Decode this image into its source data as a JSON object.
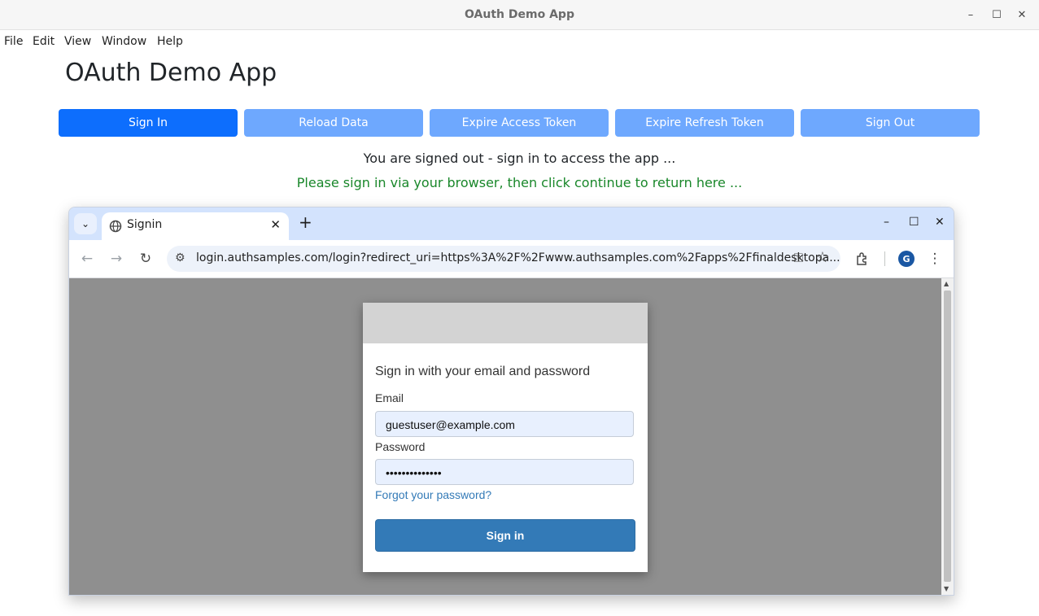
{
  "window": {
    "title": "OAuth Demo App",
    "controls": {
      "minimize": "–",
      "maximize": "☐",
      "close": "✕"
    }
  },
  "menubar": {
    "items": [
      "File",
      "Edit",
      "View",
      "Window",
      "Help"
    ]
  },
  "app": {
    "title": "OAuth Demo App",
    "buttons": [
      "Sign In",
      "Reload Data",
      "Expire Access Token",
      "Expire Refresh Token",
      "Sign Out"
    ],
    "status_message": "You are signed out - sign in to access the app ...",
    "info_message": "Please sign in via your browser, then click continue to return here ...",
    "colors": {
      "primary": "#0d6efd",
      "disabled": "#6ea8fe",
      "info_text": "#19872a"
    }
  },
  "browser": {
    "tab": {
      "title": "Signin",
      "close": "✕"
    },
    "new_tab": "+",
    "tab_search": "⌄",
    "window_controls": {
      "minimize": "–",
      "maximize": "☐",
      "close": "✕"
    },
    "url": "login.authsamples.com/login?redirect_uri=https%3A%2F%2Fwww.authsamples.com%2Fapps%2Ffinaldesktopa...",
    "avatar_initial": "G",
    "icons": [
      "back-icon",
      "forward-icon",
      "reload-icon",
      "site-settings-icon",
      "key-icon",
      "star-icon",
      "extensions-icon",
      "more-icon"
    ]
  },
  "login": {
    "heading": "Sign in with your email and password",
    "email_label": "Email",
    "email_value": "guestuser@example.com",
    "password_label": "Password",
    "password_value": "••••••••••••••",
    "forgot_link": "Forgot your password?",
    "submit_label": "Sign in",
    "colors": {
      "button": "#337ab7",
      "field_bg": "#e8f0fe",
      "page_bg": "#8f8f8f"
    }
  }
}
